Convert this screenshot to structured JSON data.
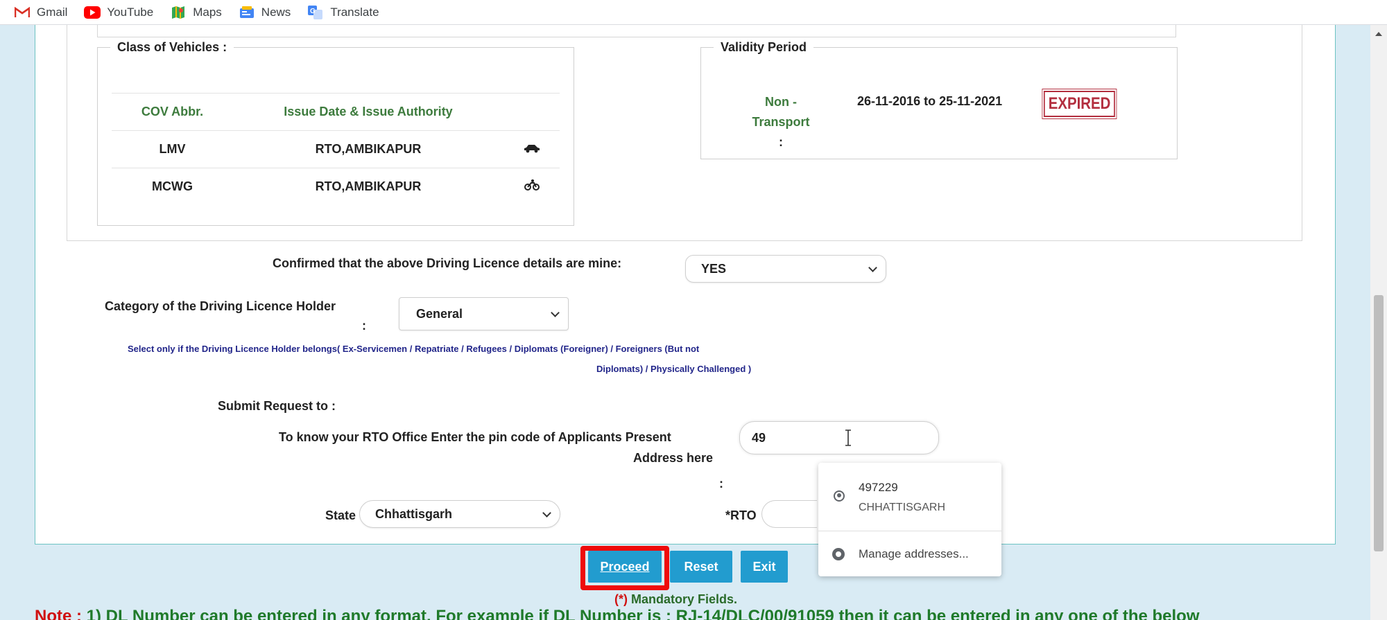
{
  "bookmarks": [
    {
      "label": "Gmail",
      "icon": "gmail-icon",
      "color": "#d93025"
    },
    {
      "label": "YouTube",
      "icon": "youtube-icon",
      "color": "#ff0000"
    },
    {
      "label": "Maps",
      "icon": "maps-icon",
      "color": "#34a853"
    },
    {
      "label": "News",
      "icon": "news-icon",
      "color": "#4285f4"
    },
    {
      "label": "Translate",
      "icon": "translate-icon",
      "color": "#4285f4"
    }
  ],
  "cov": {
    "legend": "Class of Vehicles :",
    "headers": {
      "abbr": "COV Abbr.",
      "issue": "Issue Date & Issue Authority"
    },
    "rows": [
      {
        "abbr": "LMV",
        "authority": "RTO,AMBIKAPUR",
        "icon": "car-icon"
      },
      {
        "abbr": "MCWG",
        "authority": "RTO,AMBIKAPUR",
        "icon": "motorcycle-icon"
      }
    ]
  },
  "validity": {
    "legend": "Validity Period",
    "label_line1": "Non -",
    "label_line2": "Transport",
    "label_colon": ":",
    "dates": "26-11-2016 to 25-11-2021",
    "stamp": "EXPIRED"
  },
  "confirm": {
    "label": "Confirmed that the above Driving Licence details are mine:",
    "value": "YES"
  },
  "category": {
    "label": "Category of the Driving Licence Holder",
    "colon": ":",
    "value": "General",
    "hint_line1": "Select only if the Driving Licence Holder belongs( Ex-Servicemen / Repatriate / Refugees / Diplomats (Foreigner) / Foreigners (But not",
    "hint_line2": "Diplomats) / Physically Challenged )"
  },
  "submit": {
    "heading": "Submit Request to :",
    "pin_label_line1": "To know your RTO Office Enter the pin code of Applicants Present",
    "pin_label_line2": "Address here",
    "pin_colon": ":",
    "pin_value": "49",
    "state_label": "State",
    "state_value": "Chhattisgarh",
    "rto_label": "*RTO"
  },
  "autocomplete": {
    "pin": "497229",
    "state": "CHHATTISGARH",
    "manage": "Manage addresses..."
  },
  "buttons": {
    "proceed": "Proceed",
    "reset": "Reset",
    "exit": "Exit"
  },
  "mandatory": {
    "star": "(*)",
    "text": " Mandatory Fields."
  },
  "note": {
    "label": "Note :",
    "text": " 1) DL Number can be entered in any format. For example if DL Number is : RJ-14/DLC/00/91059 then it can be entered in any one of the below"
  },
  "colors": {
    "button": "#229ccf",
    "highlight": "#ee0b0b",
    "green_label": "#3d7b3d",
    "hint_blue": "#22268a"
  }
}
